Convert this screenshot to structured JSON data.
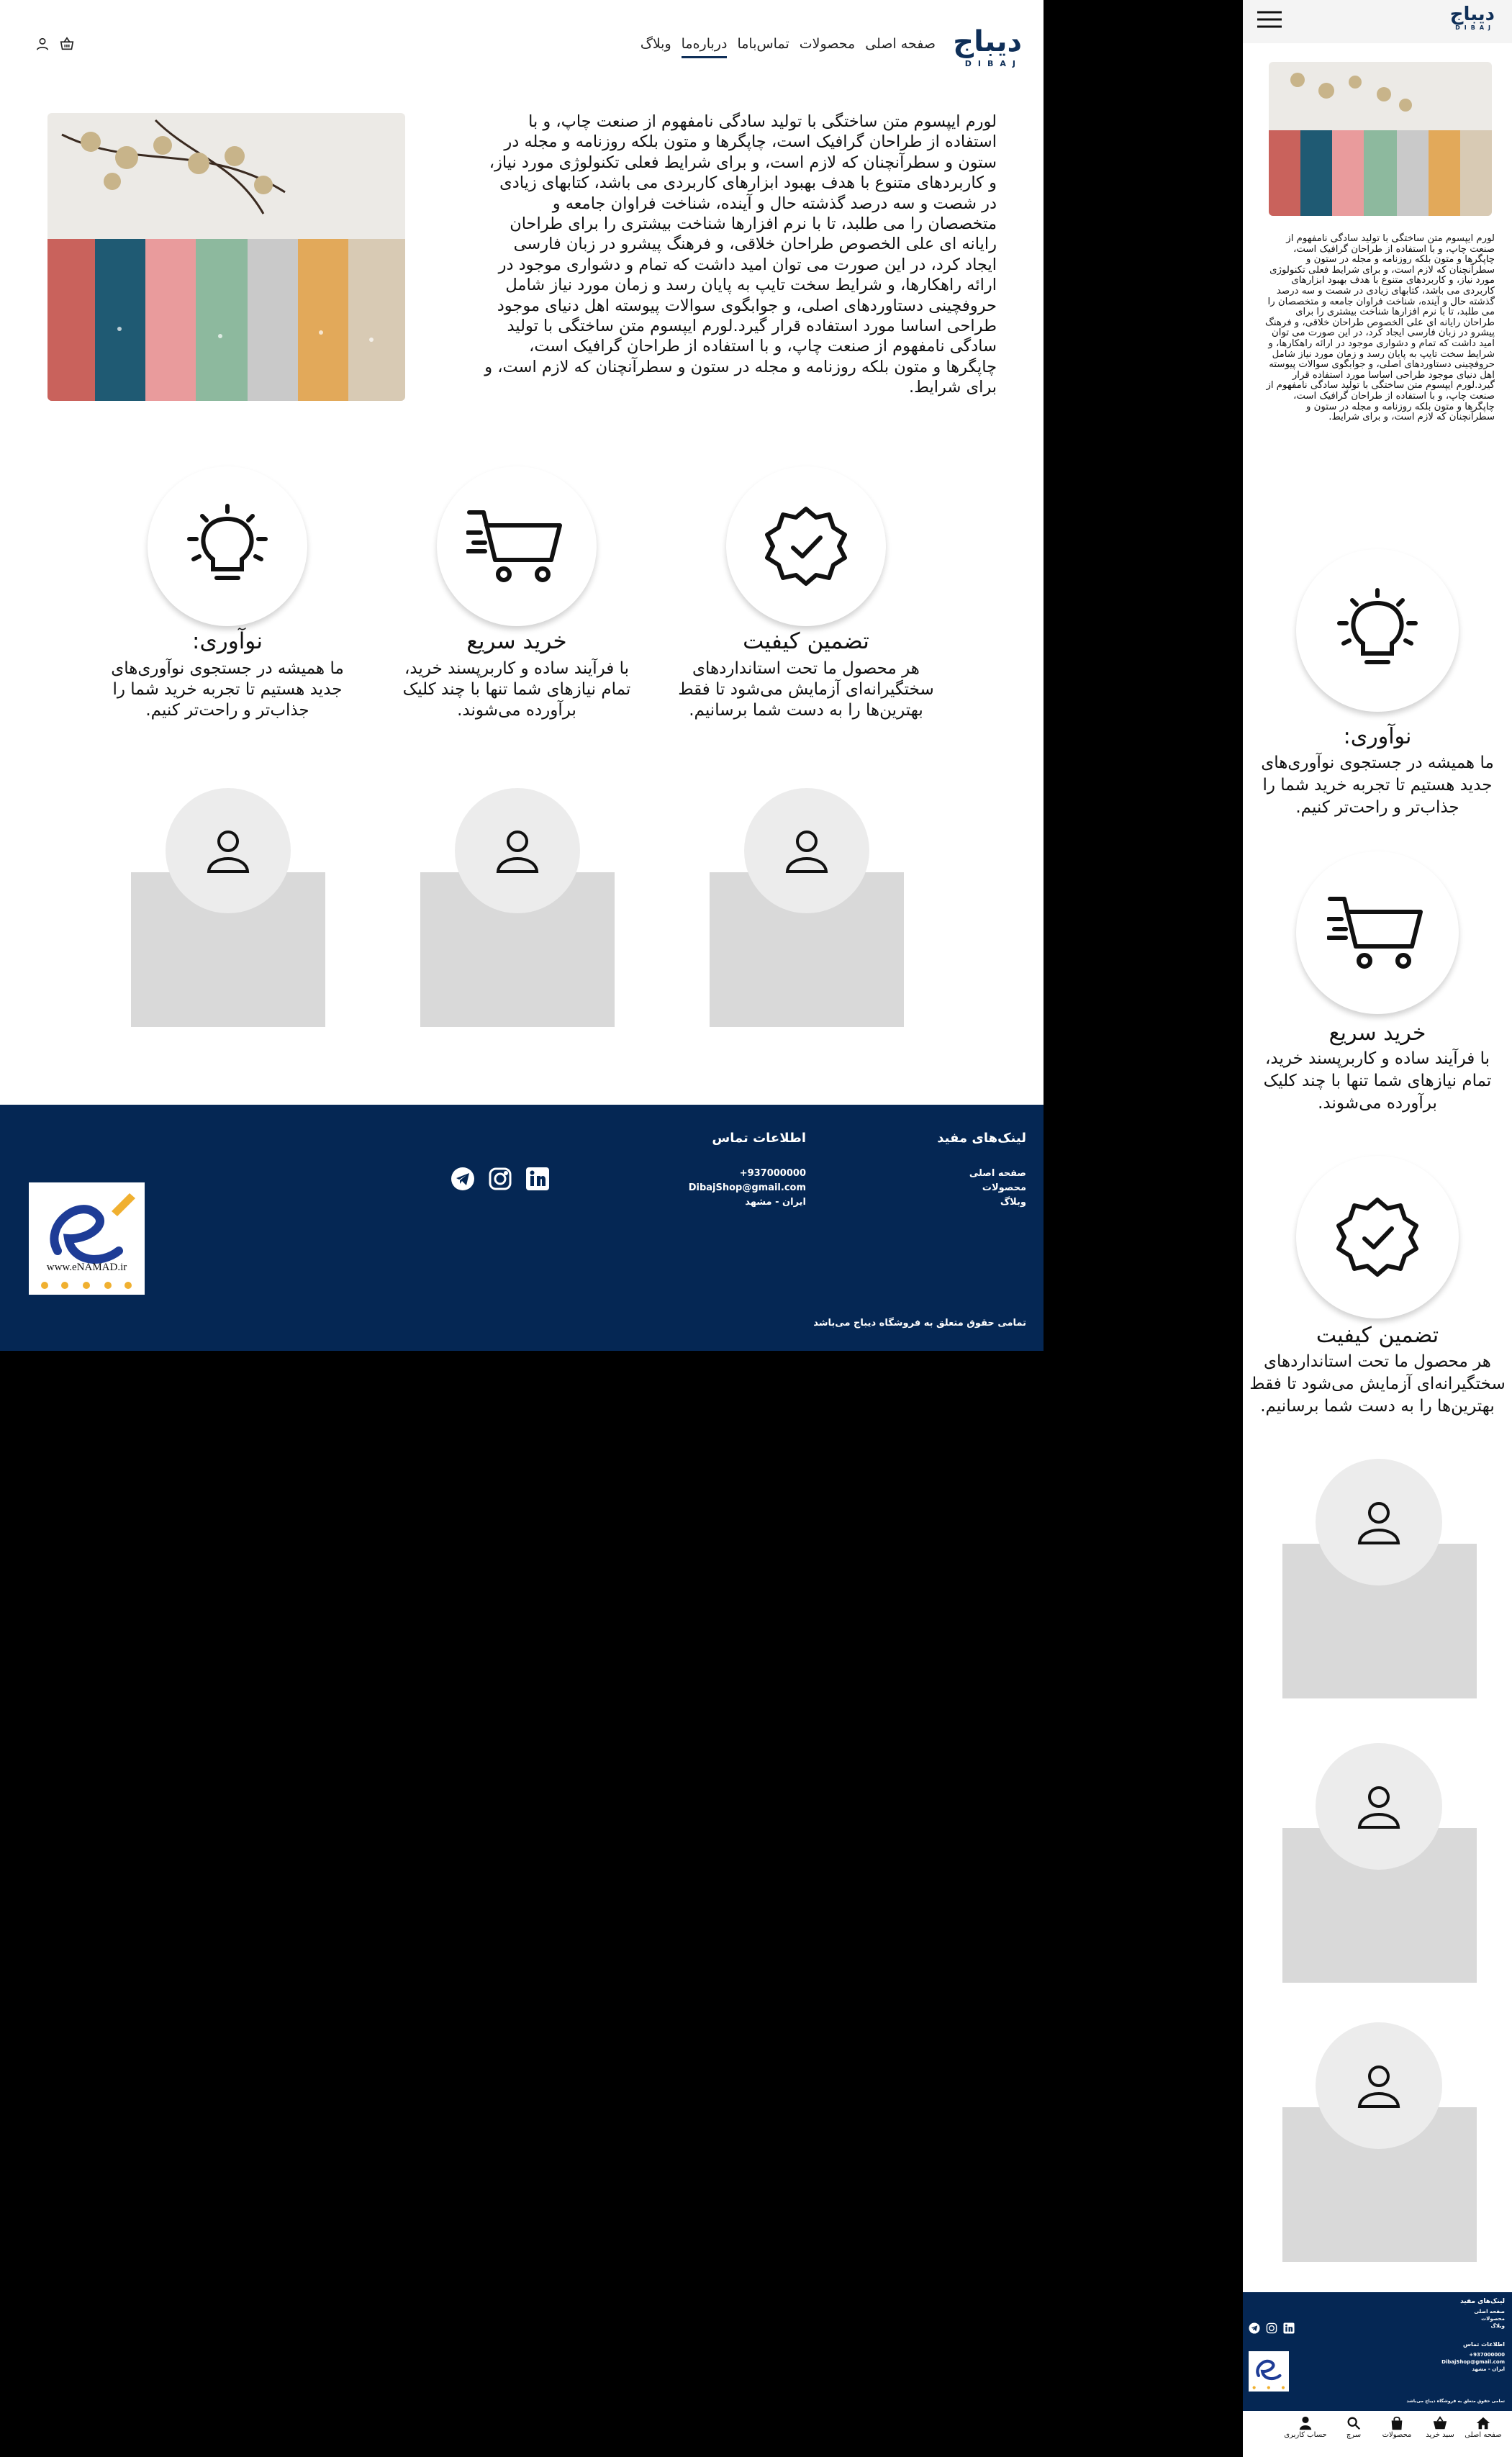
{
  "brand": {
    "name_fa": "دیباج",
    "name_en": "DIBAJ"
  },
  "nav": {
    "items": [
      {
        "label": "صفحه اصلی"
      },
      {
        "label": "محصولات"
      },
      {
        "label": "تماس‌باما"
      },
      {
        "label": "درباره‌ما"
      },
      {
        "label": "وبلاگ"
      }
    ],
    "active": "درباره‌ما",
    "user_icon": "user-icon",
    "cart_icon": "basket-icon",
    "menu_icon": "hamburger-icon"
  },
  "about": {
    "text": "لورم ایپسوم متن ساختگی با تولید سادگی نامفهوم از صنعت چاپ، و با استفاده از طراحان گرافیک است، چاپگرها و متون بلکه روزنامه و مجله در ستون و سطرآنچنان که لازم است، و برای شرایط فعلی تکنولوژی مورد نیاز، و کاربردهای متنوع با هدف بهبود ابزارهای کاربردی می باشد، کتابهای زیادی در شصت و سه درصد گذشته حال و آینده، شناخت فراوان جامعه و متخصصان را می طلبد، تا با نرم افزارها شناخت بیشتری را برای طراحان رایانه ای علی الخصوص طراحان خلاقی، و فرهنگ پیشرو در زبان فارسی ایجاد کرد، در این صورت می توان امید داشت که تمام و دشواری موجود در ارائه راهکارها، و شرایط سخت تایپ به پایان رسد و زمان مورد نیاز شامل حروفچینی دستاوردهای اصلی، و جوابگوی سوالات پیوسته اهل دنیای موجود طراحی اساسا مورد استفاده قرار گیرد.لورم ایپسوم متن ساختگی با تولید سادگی نامفهوم از صنعت چاپ، و با استفاده از طراحان گرافیک است، چاپگرها و متون بلکه روزنامه و مجله در ستون و سطرآنچنان که لازم است، و برای شرایط."
  },
  "features": [
    {
      "icon": "lightbulb-icon",
      "title": "نوآوری:",
      "desc": "ما همیشه در جستجوی نوآوری‌های جدید هستیم تا تجربه خرید شما را جذاب‌تر و راحت‌تر کنیم."
    },
    {
      "icon": "cart-icon",
      "title": "خرید سریع",
      "desc": "با فرآیند ساده و کاربرپسند خرید، تمام نیازهای شما تنها با چند کلیک برآورده می‌شوند."
    },
    {
      "icon": "quality-badge-icon",
      "title": "تضمین کیفیت",
      "desc": "هر محصول ما تحت استانداردهای سختگیرانه‌ای آزمایش می‌شود تا فقط بهترین‌ها را به دست شما برسانیم."
    }
  ],
  "team_cards": [
    {
      "icon": "person-icon"
    },
    {
      "icon": "person-icon"
    },
    {
      "icon": "person-icon"
    }
  ],
  "footer": {
    "links_title": "لینک‌های مفید",
    "links": [
      "صفحه اصلی",
      "محصولات",
      "وبلاگ"
    ],
    "contact_title": "اطلاعات تماس",
    "phone": "+937000000",
    "email": "DibajShop@gmail.com",
    "address": "ایران - مشهد",
    "social": [
      "linkedin-icon",
      "instagram-icon",
      "telegram-icon"
    ],
    "copyright": "تمامی حقوق متعلق به فروشگاه دیباج می‌باشد",
    "enamad_text": "www.eNAMAD.ir"
  },
  "bottom_nav": [
    {
      "icon": "home-icon",
      "label": "صفحه اصلی"
    },
    {
      "icon": "basket-icon",
      "label": "سبد خرید"
    },
    {
      "icon": "bag-icon",
      "label": "محصولات"
    },
    {
      "icon": "search-icon",
      "label": "سرچ"
    },
    {
      "icon": "user-icon",
      "label": "حساب کاربری"
    }
  ],
  "colors": {
    "navy": "#052754",
    "brand": "#0f2f58",
    "card_gray": "#d9d9d9",
    "circle_gray": "#ececec"
  }
}
